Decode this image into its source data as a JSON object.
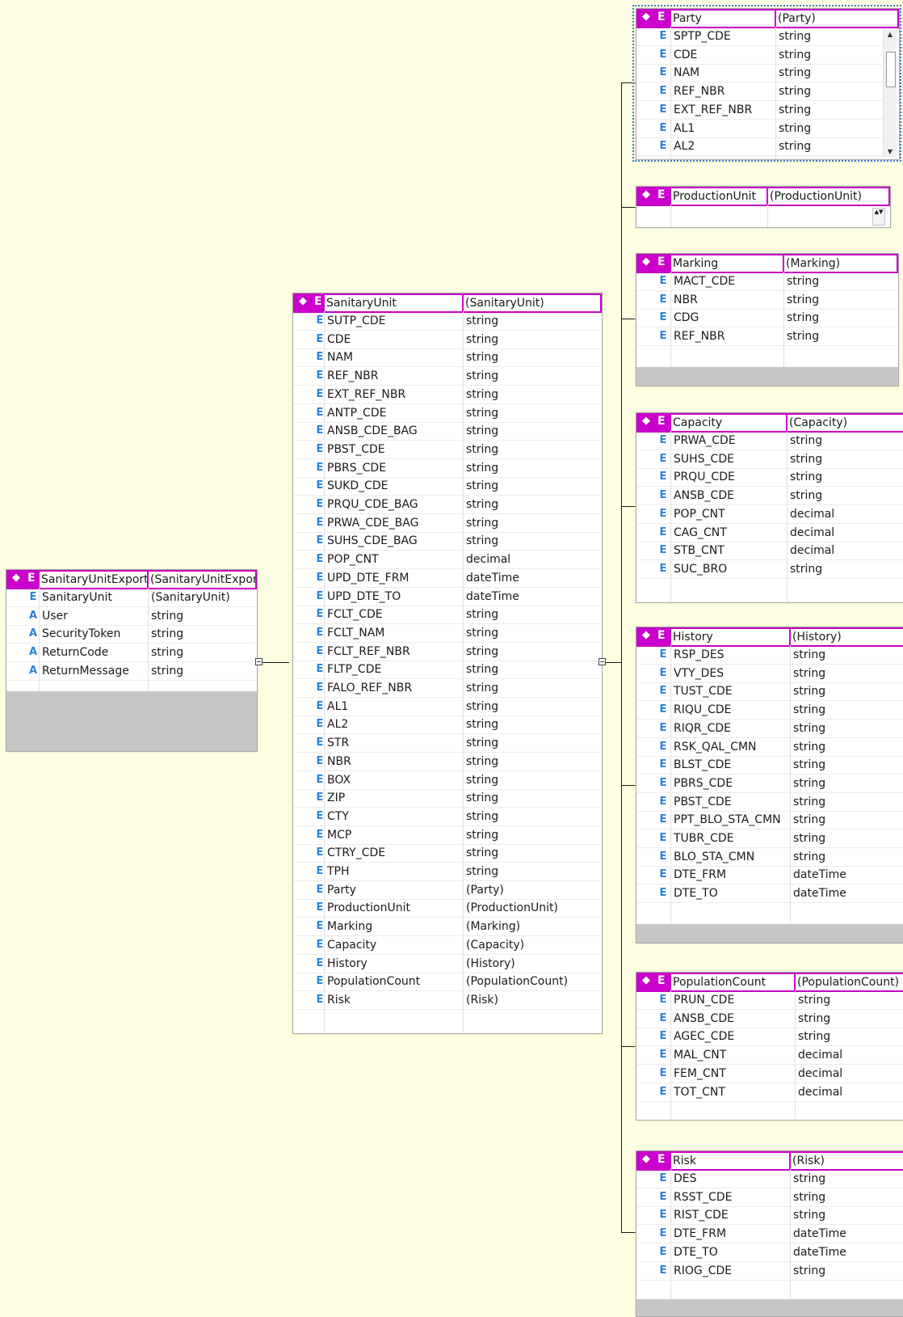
{
  "colors": {
    "header": "#cc00cc",
    "background": "#fefee2",
    "kind_letter": "#2a82d6"
  },
  "icons": {
    "element_glyph": "diamond-icon",
    "element_letter": "E",
    "attribute_letter": "A"
  },
  "entities": [
    {
      "id": "root",
      "name": "SanitaryUnitExport",
      "type": "(SanitaryUnitExport)",
      "rows": [
        {
          "kind": "E",
          "name": "SanitaryUnit",
          "type": "(SanitaryUnit)"
        },
        {
          "kind": "A",
          "name": "User",
          "type": "string"
        },
        {
          "kind": "A",
          "name": "SecurityToken",
          "type": "string"
        },
        {
          "kind": "A",
          "name": "ReturnCode",
          "type": "string"
        },
        {
          "kind": "A",
          "name": "ReturnMessage",
          "type": "string"
        }
      ]
    },
    {
      "id": "sanitary",
      "name": "SanitaryUnit",
      "type": "(SanitaryUnit)",
      "rows": [
        {
          "kind": "E",
          "name": "SUTP_CDE",
          "type": "string"
        },
        {
          "kind": "E",
          "name": "CDE",
          "type": "string"
        },
        {
          "kind": "E",
          "name": "NAM",
          "type": "string"
        },
        {
          "kind": "E",
          "name": "REF_NBR",
          "type": "string"
        },
        {
          "kind": "E",
          "name": "EXT_REF_NBR",
          "type": "string"
        },
        {
          "kind": "E",
          "name": "ANTP_CDE",
          "type": "string"
        },
        {
          "kind": "E",
          "name": "ANSB_CDE_BAG",
          "type": "string"
        },
        {
          "kind": "E",
          "name": "PBST_CDE",
          "type": "string"
        },
        {
          "kind": "E",
          "name": "PBRS_CDE",
          "type": "string"
        },
        {
          "kind": "E",
          "name": "SUKD_CDE",
          "type": "string"
        },
        {
          "kind": "E",
          "name": "PRQU_CDE_BAG",
          "type": "string"
        },
        {
          "kind": "E",
          "name": "PRWA_CDE_BAG",
          "type": "string"
        },
        {
          "kind": "E",
          "name": "SUHS_CDE_BAG",
          "type": "string"
        },
        {
          "kind": "E",
          "name": "POP_CNT",
          "type": "decimal"
        },
        {
          "kind": "E",
          "name": "UPD_DTE_FRM",
          "type": "dateTime"
        },
        {
          "kind": "E",
          "name": "UPD_DTE_TO",
          "type": "dateTime"
        },
        {
          "kind": "E",
          "name": "FCLT_CDE",
          "type": "string"
        },
        {
          "kind": "E",
          "name": "FCLT_NAM",
          "type": "string"
        },
        {
          "kind": "E",
          "name": "FCLT_REF_NBR",
          "type": "string"
        },
        {
          "kind": "E",
          "name": "FLTP_CDE",
          "type": "string"
        },
        {
          "kind": "E",
          "name": "FALO_REF_NBR",
          "type": "string"
        },
        {
          "kind": "E",
          "name": "AL1",
          "type": "string"
        },
        {
          "kind": "E",
          "name": "AL2",
          "type": "string"
        },
        {
          "kind": "E",
          "name": "STR",
          "type": "string"
        },
        {
          "kind": "E",
          "name": "NBR",
          "type": "string"
        },
        {
          "kind": "E",
          "name": "BOX",
          "type": "string"
        },
        {
          "kind": "E",
          "name": "ZIP",
          "type": "string"
        },
        {
          "kind": "E",
          "name": "CTY",
          "type": "string"
        },
        {
          "kind": "E",
          "name": "MCP",
          "type": "string"
        },
        {
          "kind": "E",
          "name": "CTRY_CDE",
          "type": "string"
        },
        {
          "kind": "E",
          "name": "TPH",
          "type": "string"
        },
        {
          "kind": "E",
          "name": "Party",
          "type": "(Party)"
        },
        {
          "kind": "E",
          "name": "ProductionUnit",
          "type": "(ProductionUnit)"
        },
        {
          "kind": "E",
          "name": "Marking",
          "type": "(Marking)"
        },
        {
          "kind": "E",
          "name": "Capacity",
          "type": "(Capacity)"
        },
        {
          "kind": "E",
          "name": "History",
          "type": "(History)"
        },
        {
          "kind": "E",
          "name": "PopulationCount",
          "type": "(PopulationCount)"
        },
        {
          "kind": "E",
          "name": "Risk",
          "type": "(Risk)"
        }
      ]
    },
    {
      "id": "party",
      "name": "Party",
      "type": "(Party)",
      "rows": [
        {
          "kind": "E",
          "name": "SPTP_CDE",
          "type": "string"
        },
        {
          "kind": "E",
          "name": "CDE",
          "type": "string"
        },
        {
          "kind": "E",
          "name": "NAM",
          "type": "string"
        },
        {
          "kind": "E",
          "name": "REF_NBR",
          "type": "string"
        },
        {
          "kind": "E",
          "name": "EXT_REF_NBR",
          "type": "string"
        },
        {
          "kind": "E",
          "name": "AL1",
          "type": "string"
        },
        {
          "kind": "E",
          "name": "AL2",
          "type": "string"
        }
      ]
    },
    {
      "id": "production",
      "name": "ProductionUnit",
      "type": "(ProductionUnit)",
      "rows": []
    },
    {
      "id": "marking",
      "name": "Marking",
      "type": "(Marking)",
      "rows": [
        {
          "kind": "E",
          "name": "MACT_CDE",
          "type": "string"
        },
        {
          "kind": "E",
          "name": "NBR",
          "type": "string"
        },
        {
          "kind": "E",
          "name": "CDG",
          "type": "string"
        },
        {
          "kind": "E",
          "name": "REF_NBR",
          "type": "string"
        }
      ]
    },
    {
      "id": "capacity",
      "name": "Capacity",
      "type": "(Capacity)",
      "rows": [
        {
          "kind": "E",
          "name": "PRWA_CDE",
          "type": "string"
        },
        {
          "kind": "E",
          "name": "SUHS_CDE",
          "type": "string"
        },
        {
          "kind": "E",
          "name": "PRQU_CDE",
          "type": "string"
        },
        {
          "kind": "E",
          "name": "ANSB_CDE",
          "type": "string"
        },
        {
          "kind": "E",
          "name": "POP_CNT",
          "type": "decimal"
        },
        {
          "kind": "E",
          "name": "CAG_CNT",
          "type": "decimal"
        },
        {
          "kind": "E",
          "name": "STB_CNT",
          "type": "decimal"
        },
        {
          "kind": "E",
          "name": "SUC_BRO",
          "type": "string"
        }
      ]
    },
    {
      "id": "history",
      "name": "History",
      "type": "(History)",
      "rows": [
        {
          "kind": "E",
          "name": "RSP_DES",
          "type": "string"
        },
        {
          "kind": "E",
          "name": "VTY_DES",
          "type": "string"
        },
        {
          "kind": "E",
          "name": "TUST_CDE",
          "type": "string"
        },
        {
          "kind": "E",
          "name": "RIQU_CDE",
          "type": "string"
        },
        {
          "kind": "E",
          "name": "RIQR_CDE",
          "type": "string"
        },
        {
          "kind": "E",
          "name": "RSK_QAL_CMN",
          "type": "string"
        },
        {
          "kind": "E",
          "name": "BLST_CDE",
          "type": "string"
        },
        {
          "kind": "E",
          "name": "PBRS_CDE",
          "type": "string"
        },
        {
          "kind": "E",
          "name": "PBST_CDE",
          "type": "string"
        },
        {
          "kind": "E",
          "name": "PPT_BLO_STA_CMN",
          "type": "string"
        },
        {
          "kind": "E",
          "name": "TUBR_CDE",
          "type": "string"
        },
        {
          "kind": "E",
          "name": "BLO_STA_CMN",
          "type": "string"
        },
        {
          "kind": "E",
          "name": "DTE_FRM",
          "type": "dateTime"
        },
        {
          "kind": "E",
          "name": "DTE_TO",
          "type": "dateTime"
        }
      ]
    },
    {
      "id": "population",
      "name": "PopulationCount",
      "type": "(PopulationCount)",
      "rows": [
        {
          "kind": "E",
          "name": "PRUN_CDE",
          "type": "string"
        },
        {
          "kind": "E",
          "name": "ANSB_CDE",
          "type": "string"
        },
        {
          "kind": "E",
          "name": "AGEC_CDE",
          "type": "string"
        },
        {
          "kind": "E",
          "name": "MAL_CNT",
          "type": "decimal"
        },
        {
          "kind": "E",
          "name": "FEM_CNT",
          "type": "decimal"
        },
        {
          "kind": "E",
          "name": "TOT_CNT",
          "type": "decimal"
        }
      ]
    },
    {
      "id": "risk",
      "name": "Risk",
      "type": "(Risk)",
      "rows": [
        {
          "kind": "E",
          "name": "DES",
          "type": "string"
        },
        {
          "kind": "E",
          "name": "RSST_CDE",
          "type": "string"
        },
        {
          "kind": "E",
          "name": "RIST_CDE",
          "type": "string"
        },
        {
          "kind": "E",
          "name": "DTE_FRM",
          "type": "dateTime"
        },
        {
          "kind": "E",
          "name": "DTE_TO",
          "type": "dateTime"
        },
        {
          "kind": "E",
          "name": "RIOG_CDE",
          "type": "string"
        }
      ]
    }
  ]
}
